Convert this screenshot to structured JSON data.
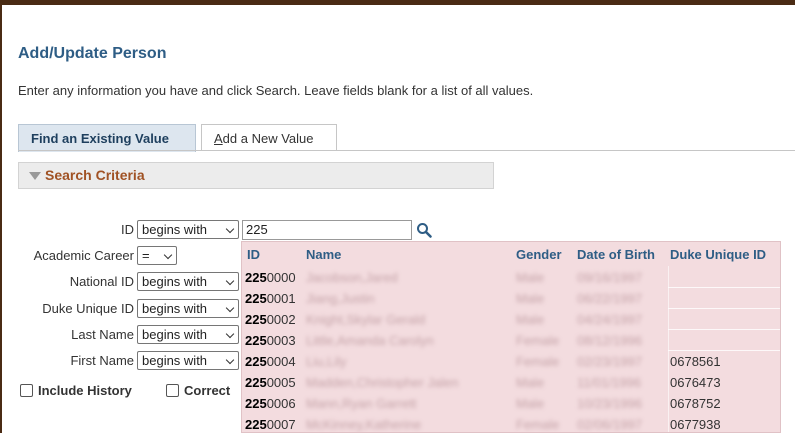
{
  "page": {
    "title": "Add/Update Person",
    "instructions": "Enter any information you have and click Search. Leave fields blank for a list of all values."
  },
  "tabs": [
    {
      "label": "Find an Existing Value",
      "active": true
    },
    {
      "label_first": "A",
      "label_rest": "dd a New Value",
      "active": false
    }
  ],
  "criteria": {
    "title": "Search Criteria"
  },
  "fields": {
    "id": {
      "label": "ID",
      "operator": "begins with",
      "value": "225"
    },
    "academic_career": {
      "label": "Academic Career",
      "operator": "="
    },
    "national_id": {
      "label": "National ID",
      "operator": "begins with"
    },
    "duke_unique_id": {
      "label": "Duke Unique ID",
      "operator": "begins with"
    },
    "last_name": {
      "label": "Last Name",
      "operator": "begins with"
    },
    "first_name": {
      "label": "First Name",
      "operator": "begins with"
    }
  },
  "checkboxes": {
    "include_history": {
      "label": "Include History",
      "checked": false
    },
    "correct_history": {
      "label": "Correct",
      "checked": false
    }
  },
  "results": {
    "headers": {
      "id": "ID",
      "name": "Name",
      "gender": "Gender",
      "dob": "Date of Birth",
      "duke_unique_id": "Duke Unique ID"
    },
    "rows": [
      {
        "id_prefix": "225",
        "id_suffix": "0000",
        "name": "Jacobson,Jared",
        "gender": "Male",
        "dob": "09/16/1997",
        "uid": ""
      },
      {
        "id_prefix": "225",
        "id_suffix": "0001",
        "name": "Jiang,Justin",
        "gender": "Male",
        "dob": "06/22/1997",
        "uid": ""
      },
      {
        "id_prefix": "225",
        "id_suffix": "0002",
        "name": "Knight,Skylar Gerald",
        "gender": "Male",
        "dob": "04/24/1997",
        "uid": ""
      },
      {
        "id_prefix": "225",
        "id_suffix": "0003",
        "name": "Little,Amanda Carolyn",
        "gender": "Female",
        "dob": "08/12/1996",
        "uid": ""
      },
      {
        "id_prefix": "225",
        "id_suffix": "0004",
        "name": "Liu,Lily",
        "gender": "Female",
        "dob": "02/23/1997",
        "uid": "0678561"
      },
      {
        "id_prefix": "225",
        "id_suffix": "0005",
        "name": "Madden,Christopher Jalen",
        "gender": "Male",
        "dob": "11/01/1996",
        "uid": "0676473"
      },
      {
        "id_prefix": "225",
        "id_suffix": "0006",
        "name": "Mann,Ryan Garrett",
        "gender": "Male",
        "dob": "10/23/1996",
        "uid": "0678752"
      },
      {
        "id_prefix": "225",
        "id_suffix": "0007",
        "name": "McKinney,Katherine",
        "gender": "Female",
        "dob": "02/06/1997",
        "uid": "0677938"
      }
    ]
  },
  "colors": {
    "title": "#2e5d85",
    "criteria_title": "#a05224",
    "dropdown_bg": "#f3dcdf",
    "frame": "#4a2b14"
  },
  "icons": {
    "lookup": "magnifier-icon",
    "collapse": "triangle-down-icon"
  }
}
